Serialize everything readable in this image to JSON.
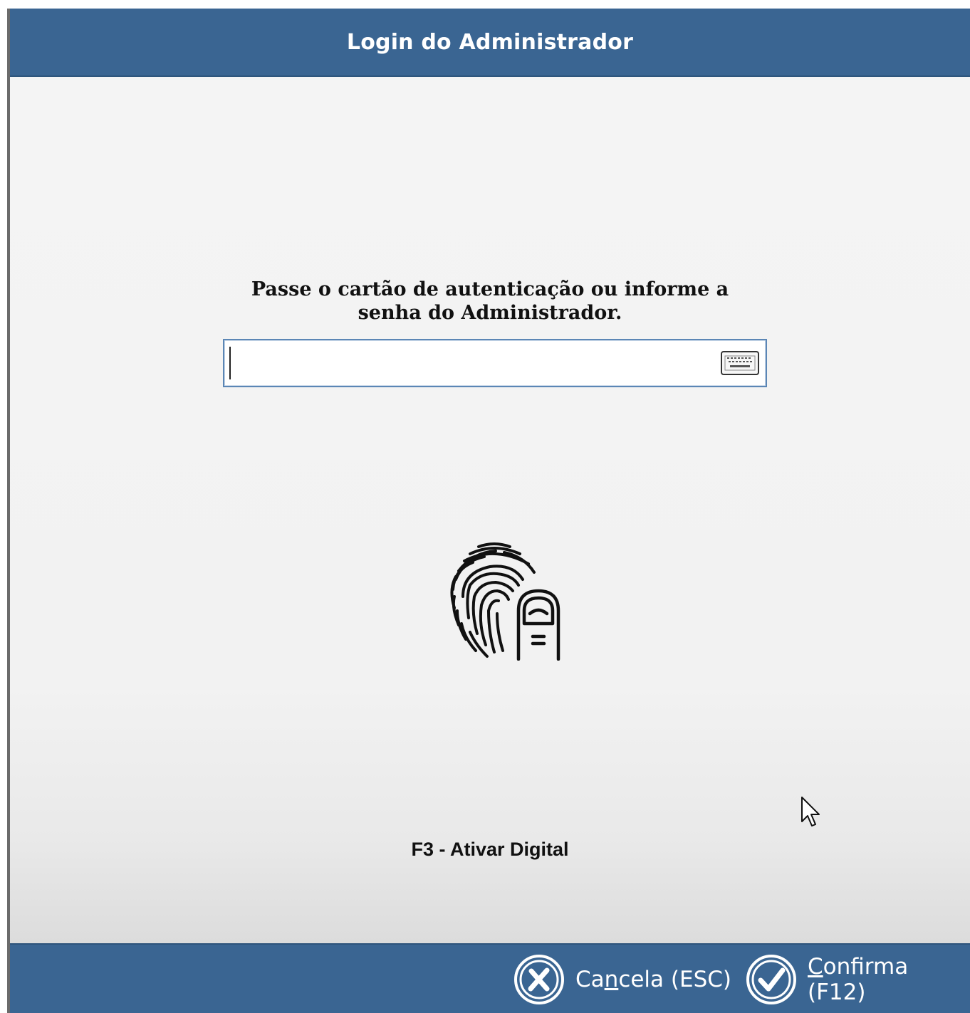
{
  "window": {
    "title": "Login do Administrador"
  },
  "prompt": {
    "line1": "Passe o cartão de autenticação ou informe a",
    "line2": "senha do Administrador."
  },
  "password_field": {
    "value": "",
    "placeholder": ""
  },
  "icons": {
    "keyboard": "keyboard-icon",
    "fingerprint": "fingerprint-icon",
    "cursor": "mouse-pointer-icon",
    "cancel": "x-circle-icon",
    "confirm": "check-circle-icon"
  },
  "biometric": {
    "activate_label": "F3 - Ativar Digital"
  },
  "footer": {
    "cancel": {
      "pre": "Ca",
      "accel": "n",
      "post": "cela (ESC)"
    },
    "confirm": {
      "pre": "",
      "accel": "C",
      "post": "onfirma (F12)"
    }
  },
  "colors": {
    "header_bg": "#3a6592",
    "footer_bg": "#3a6592",
    "content_bg": "#f3f3f3",
    "field_border": "#5b86b5"
  }
}
